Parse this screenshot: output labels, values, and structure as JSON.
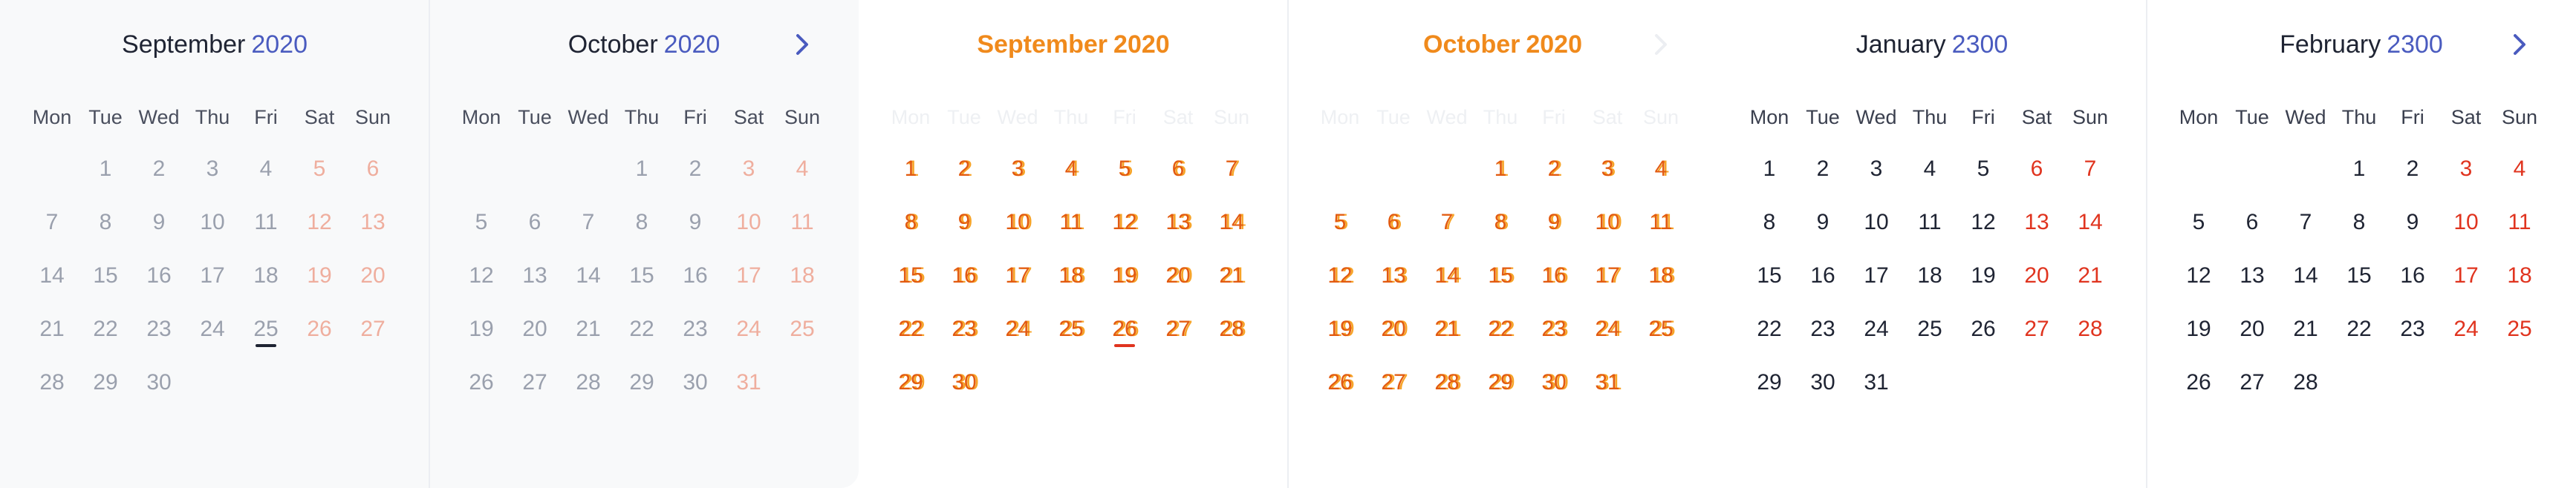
{
  "weekdays": [
    "Mon",
    "Tue",
    "Wed",
    "Thu",
    "Fri",
    "Sat",
    "Sun"
  ],
  "colors": {
    "accent_year": "#4a5bbf",
    "weekend": "#e0341f",
    "ghost_orange": "#f08a1c"
  },
  "panels": [
    {
      "variant": "faded",
      "calendars": [
        {
          "month": "September",
          "year": "2020",
          "offset": 1,
          "days": 30,
          "today": 25,
          "nav_next": false
        },
        {
          "month": "October",
          "year": "2020",
          "offset": 3,
          "days": 31,
          "today": null,
          "nav_next": true
        }
      ]
    },
    {
      "variant": "ghost",
      "calendars": [
        {
          "month": "September",
          "year": "2020",
          "offset": 0,
          "days": 30,
          "today": 26,
          "nav_next": false
        },
        {
          "month": "October",
          "year": "2020",
          "offset": 3,
          "days": 31,
          "today": null,
          "nav_next": true
        }
      ]
    },
    {
      "variant": "normal",
      "calendars": [
        {
          "month": "January",
          "year": "2300",
          "offset": 0,
          "days": 31,
          "today": null,
          "nav_next": false
        },
        {
          "month": "February",
          "year": "2300",
          "offset": 3,
          "days": 28,
          "today": null,
          "nav_next": true
        }
      ]
    }
  ],
  "icons": {
    "next": "chevron-right-icon"
  }
}
